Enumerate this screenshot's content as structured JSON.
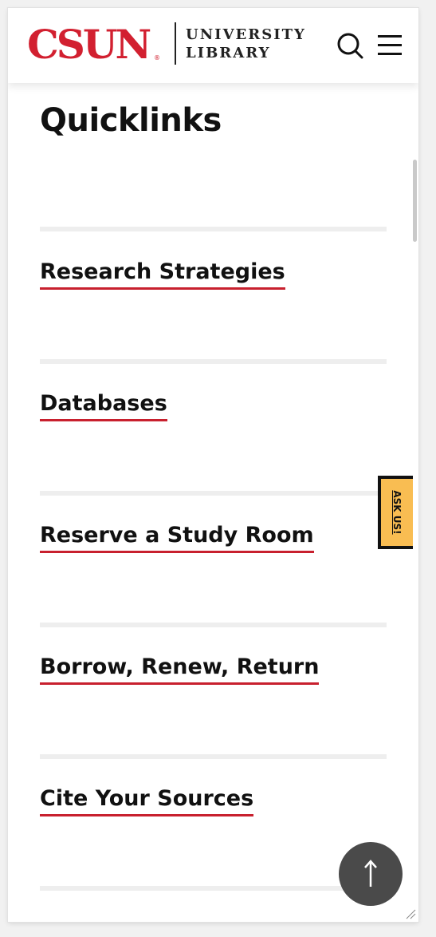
{
  "header": {
    "logo_main": "CSUN",
    "logo_registered": "®",
    "logo_line1": "UNIVERSITY",
    "logo_line2": "LIBRARY",
    "search_icon": "search-icon",
    "menu_icon": "hamburger-menu-icon"
  },
  "page": {
    "title": "Quicklinks"
  },
  "quicklinks": [
    {
      "label": "Research Strategies"
    },
    {
      "label": "Databases"
    },
    {
      "label": "Reserve a Study Room"
    },
    {
      "label": "Borrow, Renew, Return"
    },
    {
      "label": "Cite Your Sources"
    }
  ],
  "ask_tab": {
    "label": "ASK US!"
  },
  "back_to_top": {
    "icon": "arrow-up-icon"
  },
  "colors": {
    "brand_red": "#d22030",
    "underline_red": "#c8202e",
    "ask_yellow": "#f9bd52",
    "back_to_top_bg": "#4a4a4a"
  }
}
